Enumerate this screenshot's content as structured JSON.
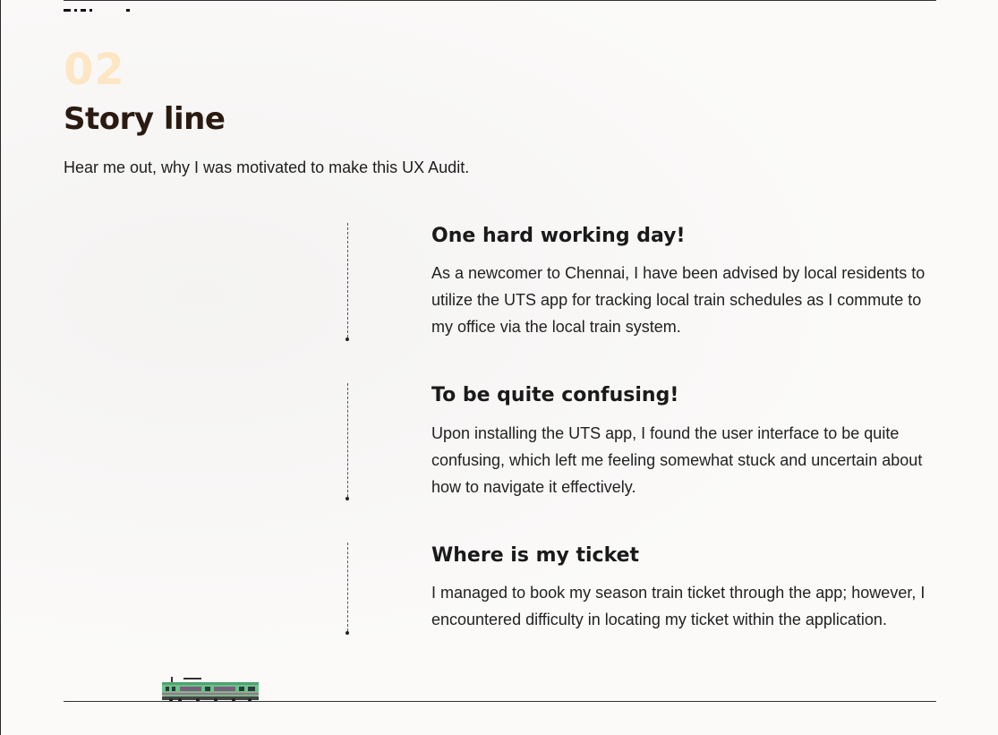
{
  "section": {
    "number": "02",
    "title": "Story line",
    "subtitle": "Hear me out, why I was motivated to make this UX Audit."
  },
  "stories": [
    {
      "heading": "One hard working day!",
      "body": "As a newcomer to Chennai, I have been advised by local residents to utilize the UTS app for tracking local train schedules as I commute to my office via the local train system."
    },
    {
      "heading": "To be quite confusing!",
      "body": "Upon installing the UTS app, I found the user interface to be quite confusing, which left me feeling somewhat stuck and uncertain about how to navigate it effectively."
    },
    {
      "heading": "Where is my ticket",
      "body": "I managed to book my season train ticket through the app; however, I encountered difficulty in locating my ticket within the application."
    }
  ],
  "illustration": {
    "icon": "train-icon",
    "colors": {
      "body": "#6cc08b",
      "window": "#7a5f7a",
      "roof": "#4fa36f"
    }
  }
}
